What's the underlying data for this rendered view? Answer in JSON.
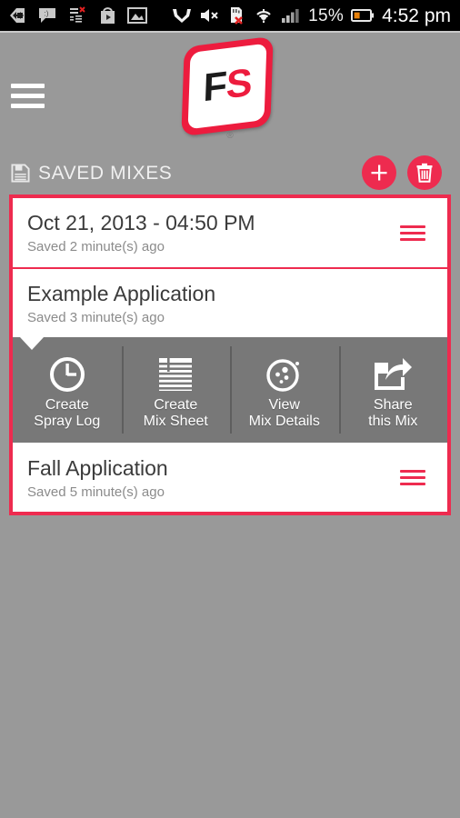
{
  "status_bar": {
    "left_icons": [
      {
        "name": "back-arrow-icon",
        "glyph": "back"
      },
      {
        "name": "messaging-icon",
        "glyph": "message"
      },
      {
        "name": "task-list-icon",
        "glyph": "tasklist"
      },
      {
        "name": "play-store-icon",
        "glyph": "playstore"
      },
      {
        "name": "gallery-image-icon",
        "glyph": "image"
      }
    ],
    "right_icons": [
      {
        "name": "gitlab-icon",
        "glyph": "fox"
      },
      {
        "name": "volume-muted-icon",
        "glyph": "mute"
      },
      {
        "name": "sd-card-removed-icon",
        "glyph": "sdcard"
      },
      {
        "name": "wifi-icon",
        "glyph": "wifi"
      },
      {
        "name": "cell-signal-icon",
        "glyph": "signal"
      }
    ],
    "battery_percent": "15%",
    "time": "4:52 pm"
  },
  "header": {
    "menu_label": "Menu",
    "logo": {
      "letter_1": "F",
      "letter_2": "S",
      "registered": "®"
    }
  },
  "section": {
    "icon": "save-floppy-icon",
    "title": "SAVED MIXES",
    "add_button_label": "+",
    "delete_button_label": "Delete"
  },
  "colors": {
    "accent_red": "#ee2b4f",
    "logo_red": "#ed1c3e",
    "background_gray": "#999999",
    "panel_gray": "#787878",
    "card_white": "#ffffff",
    "title_text": "#3b3b3b",
    "subtitle_text": "#8b8b8b",
    "status_bar_black": "#000000"
  },
  "saved_mixes": [
    {
      "title": "Oct 21, 2013 - 04:50 PM",
      "subtitle": "Saved 2 minute(s) ago",
      "expanded": false
    },
    {
      "title": "Example Application",
      "subtitle": "Saved 3 minute(s) ago",
      "expanded": true
    },
    {
      "title": "Fall Application",
      "subtitle": "Saved 5 minute(s) ago",
      "expanded": false
    }
  ],
  "action_panel": {
    "actions": [
      {
        "icon": "clock-icon",
        "label": "Create\nSpray Log"
      },
      {
        "icon": "mix-sheet-lines-icon",
        "label": "Create\nMix Sheet"
      },
      {
        "icon": "mix-details-circle-icon",
        "label": "View\nMix Details"
      },
      {
        "icon": "share-export-icon",
        "label": "Share\nthis Mix"
      }
    ]
  }
}
